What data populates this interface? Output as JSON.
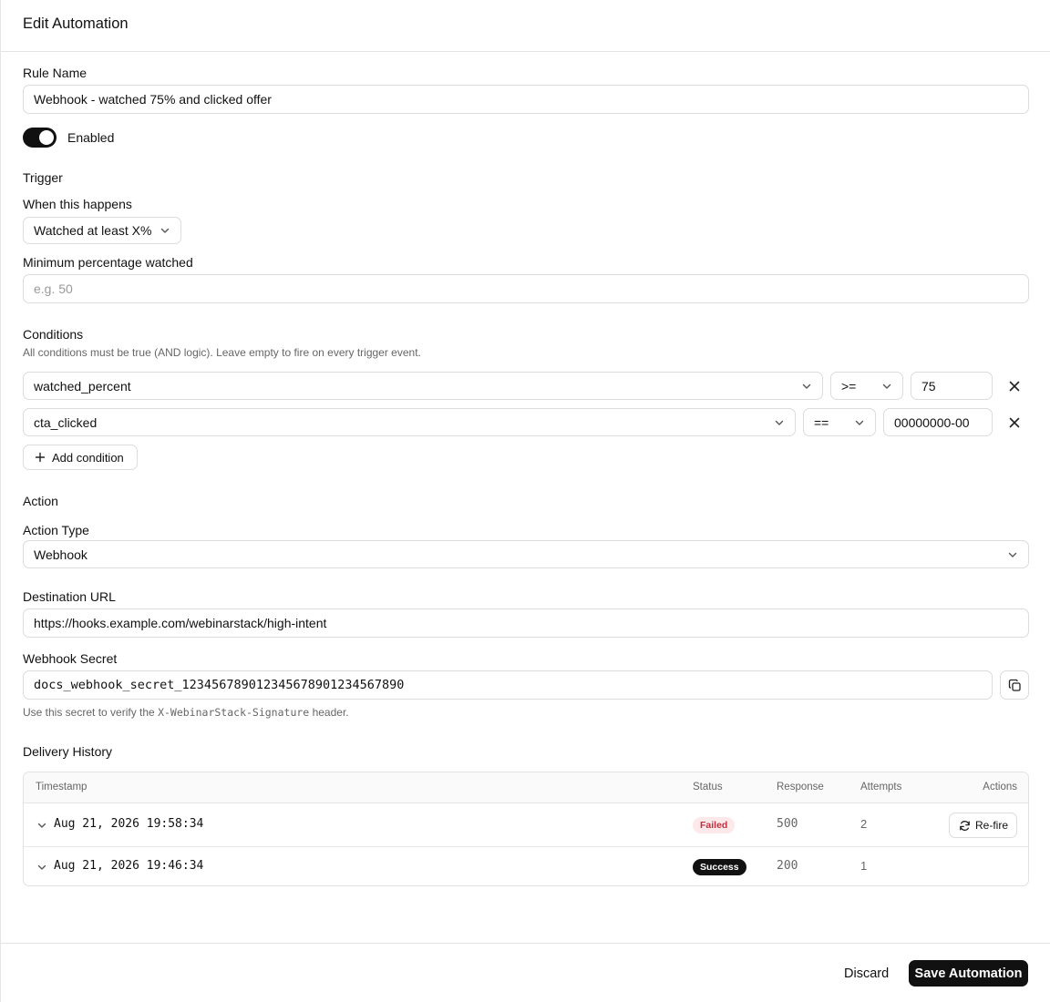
{
  "header": {
    "title": "Edit Automation"
  },
  "rule": {
    "name_label": "Rule Name",
    "name_value": "Webhook - watched 75% and clicked offer",
    "enabled_label": "Enabled",
    "enabled": true
  },
  "trigger": {
    "section_title": "Trigger",
    "when_label": "When this happens",
    "when_value": "Watched at least X%",
    "min_label": "Minimum percentage watched",
    "min_placeholder": "e.g. 50"
  },
  "conditions": {
    "section_title": "Conditions",
    "description": "All conditions must be true (AND logic). Leave empty to fire on every trigger event.",
    "items": [
      {
        "field": "watched_percent",
        "operator": ">=",
        "value": "75"
      },
      {
        "field": "cta_clicked",
        "operator": "==",
        "value": "00000000-00"
      }
    ],
    "add_label": "Add condition"
  },
  "action": {
    "section_title": "Action",
    "type_label": "Action Type",
    "type_value": "Webhook",
    "url_label": "Destination URL",
    "url_value": "https://hooks.example.com/webinarstack/high-intent",
    "secret_label": "Webhook Secret",
    "secret_value": "docs_webhook_secret_12345678901234567890123456789​0",
    "secret_hint_prefix": "Use this secret to verify the ",
    "secret_hint_code": "X-WebinarStack-Signature",
    "secret_hint_suffix": " header."
  },
  "delivery": {
    "section_title": "Delivery History",
    "columns": [
      "Timestamp",
      "Status",
      "Response",
      "Attempts",
      "Actions"
    ],
    "rows": [
      {
        "timestamp": "Aug 21, 2026 19:58:34",
        "status": "Failed",
        "response": "500",
        "attempts": "2",
        "action": "Re-fire"
      },
      {
        "timestamp": "Aug 21, 2026 19:46:34",
        "status": "Success",
        "response": "200",
        "attempts": "1",
        "action": ""
      }
    ]
  },
  "footer": {
    "discard_label": "Discard",
    "save_label": "Save Automation"
  },
  "colors": {
    "primary": "#111111",
    "failed_bg": "#fde8ea",
    "failed_text": "#c0303e",
    "border": "#dcdcdc"
  }
}
